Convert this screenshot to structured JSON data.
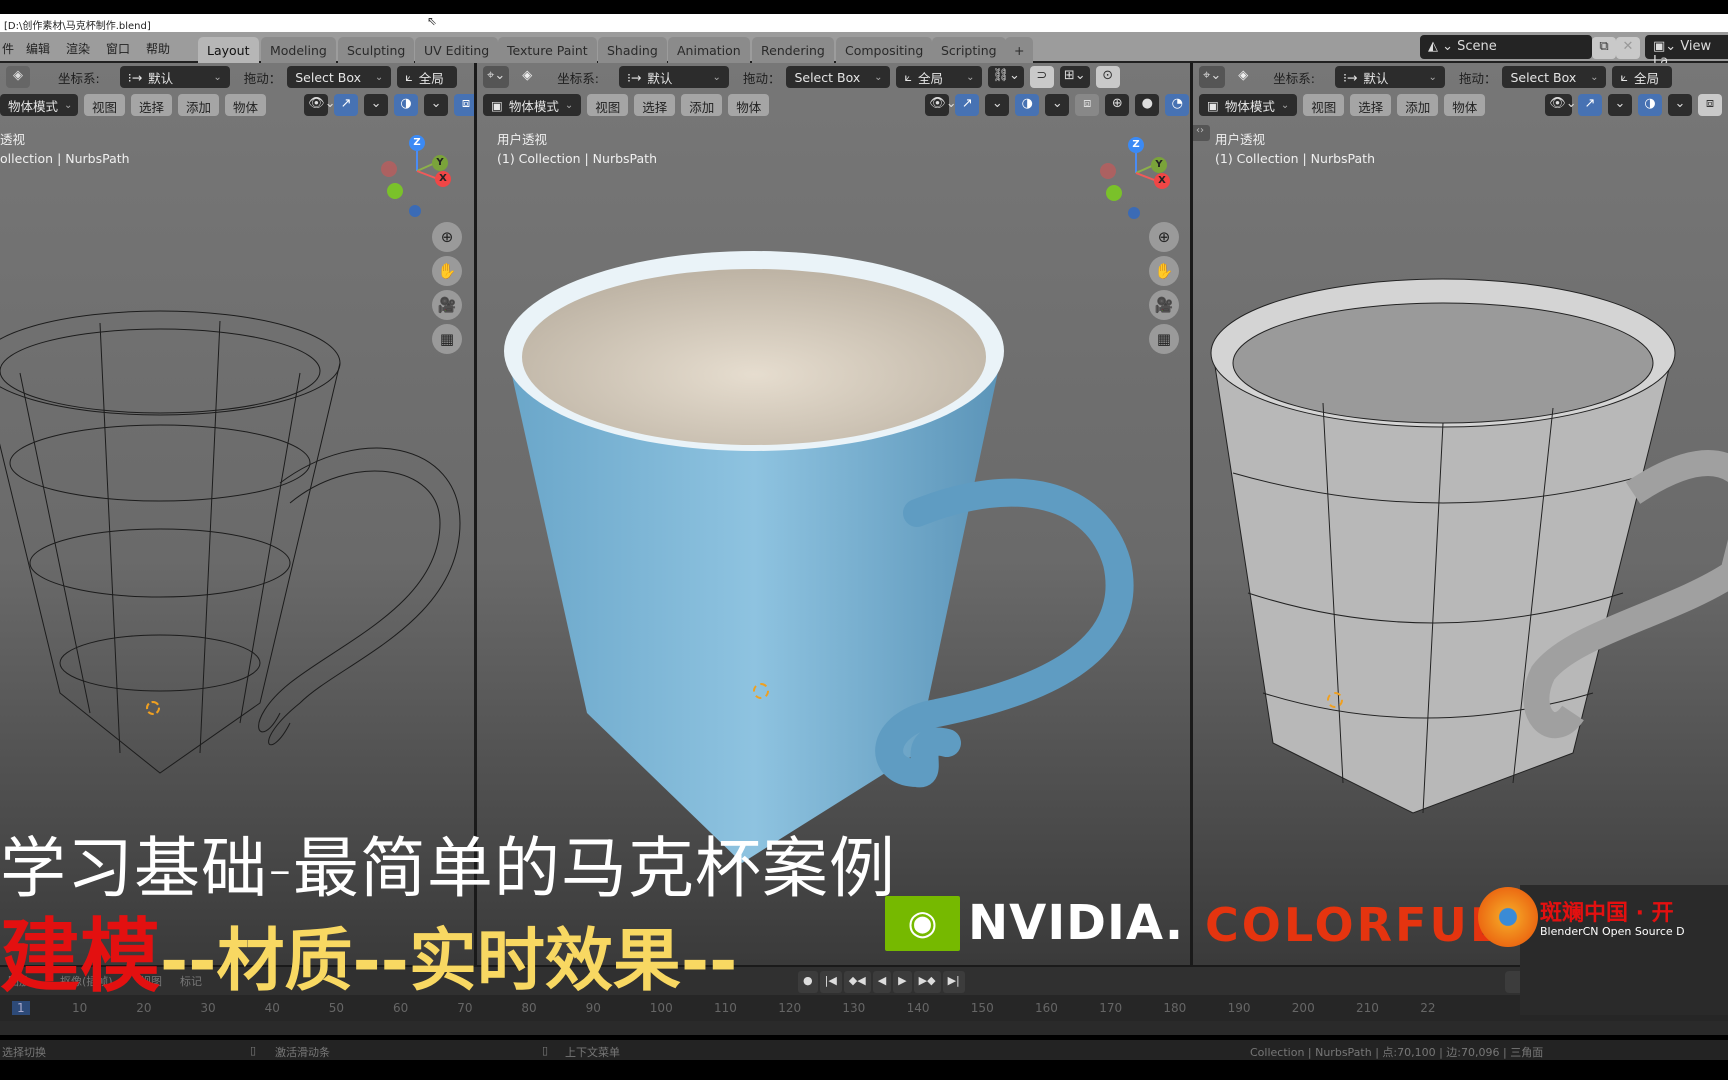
{
  "window": {
    "title": "[D:\\创作素材\\马克杯制作.blend]"
  },
  "menu": [
    "件",
    "编辑",
    "渲染",
    "窗口",
    "帮助"
  ],
  "workspace_tabs": [
    {
      "label": "Layout",
      "active": true
    },
    {
      "label": "Modeling"
    },
    {
      "label": "Sculpting"
    },
    {
      "label": "UV Editing"
    },
    {
      "label": "Texture Paint"
    },
    {
      "label": "Shading"
    },
    {
      "label": "Animation"
    },
    {
      "label": "Rendering"
    },
    {
      "label": "Compositing"
    },
    {
      "label": "Scripting"
    },
    {
      "label": "+"
    }
  ],
  "scene": {
    "name": "Scene",
    "view_layer": "View La"
  },
  "tool_header": {
    "coord_label": "坐标系:",
    "coord_value": "默认",
    "drag_label": "拖动：",
    "drag_value": "Select Box",
    "pivot_value": "全局"
  },
  "view_header": {
    "mode": "物体模式",
    "menus": [
      "视图",
      "选择",
      "添加",
      "物体"
    ]
  },
  "viewports": [
    {
      "view_name": "透视",
      "collection": "ollection | NurbsPath",
      "shading": "wireframe"
    },
    {
      "view_name": "用户透视",
      "collection": "(1) Collection | NurbsPath",
      "shading": "material"
    },
    {
      "view_name": "用户透视",
      "collection": "(1) Collection | NurbsPath",
      "shading": "solid"
    }
  ],
  "gizmo": {
    "z": "Z",
    "y": "Y",
    "x": "X"
  },
  "overlay": {
    "subtitle_line1": "学习基础-最简单的马克杯案例",
    "subtitle_red": "建模",
    "subtitle_yellow": "--材质--实时效果--",
    "nvidia": "NVIDIA.",
    "colorful": "COLORFUL",
    "colorful_mark": "®",
    "blendercn_title": "斑斓中国 · 开",
    "blendercn_sub": "BlenderCN Open Source D"
  },
  "timeline": {
    "current_frame": "1",
    "header_left": [
      "回放",
      "抠像(插帧)",
      "视图",
      "标记"
    ],
    "ticks": [
      "1",
      "10",
      "20",
      "30",
      "40",
      "50",
      "60",
      "70",
      "80",
      "90",
      "100",
      "110",
      "120",
      "130",
      "140",
      "150",
      "160",
      "170",
      "180",
      "190",
      "200",
      "210",
      "22"
    ]
  },
  "statusbar": {
    "left": "选择切换",
    "mid1": "激活滑动条",
    "mid2": "上下文菜单",
    "right": "Collection | NurbsPath | 点:70,100 | 边:70,096 | 三角面"
  }
}
